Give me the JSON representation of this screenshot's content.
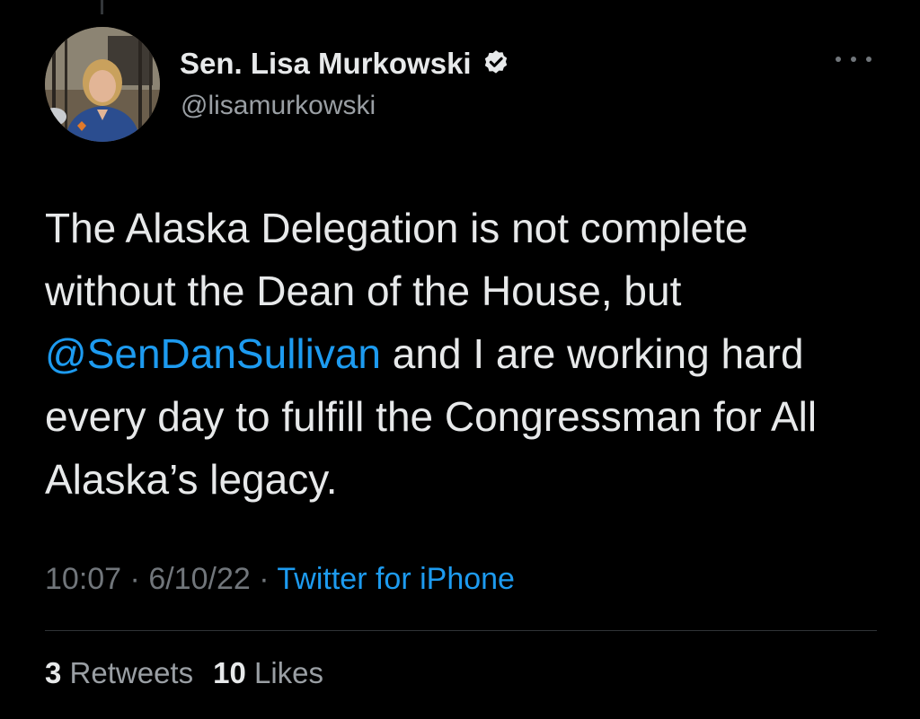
{
  "colors": {
    "background": "#000000",
    "text": "#e7e9ea",
    "secondary_text": "#71767b",
    "link": "#1d9bf0",
    "divider": "#2f3336"
  },
  "author": {
    "name": "Sen. Lisa Murkowski",
    "handle": "@lisamurkowski",
    "verified_icon": "verified-badge-icon",
    "avatar": "profile-photo"
  },
  "more_icon": "more-options-icon",
  "tweet": {
    "text_before": "The Alaska Delegation is not complete without the Dean of the House, but ",
    "mention": "@SenDanSullivan",
    "text_after": " and I are working hard every day to fulfill the Congressman for All Alaska’s legacy."
  },
  "meta": {
    "time": "10:07",
    "separator": "·",
    "date": "6/10/22",
    "source": "Twitter for iPhone"
  },
  "stats": {
    "retweets_count": "3",
    "retweets_label": "Retweets",
    "likes_count": "10",
    "likes_label": "Likes"
  }
}
